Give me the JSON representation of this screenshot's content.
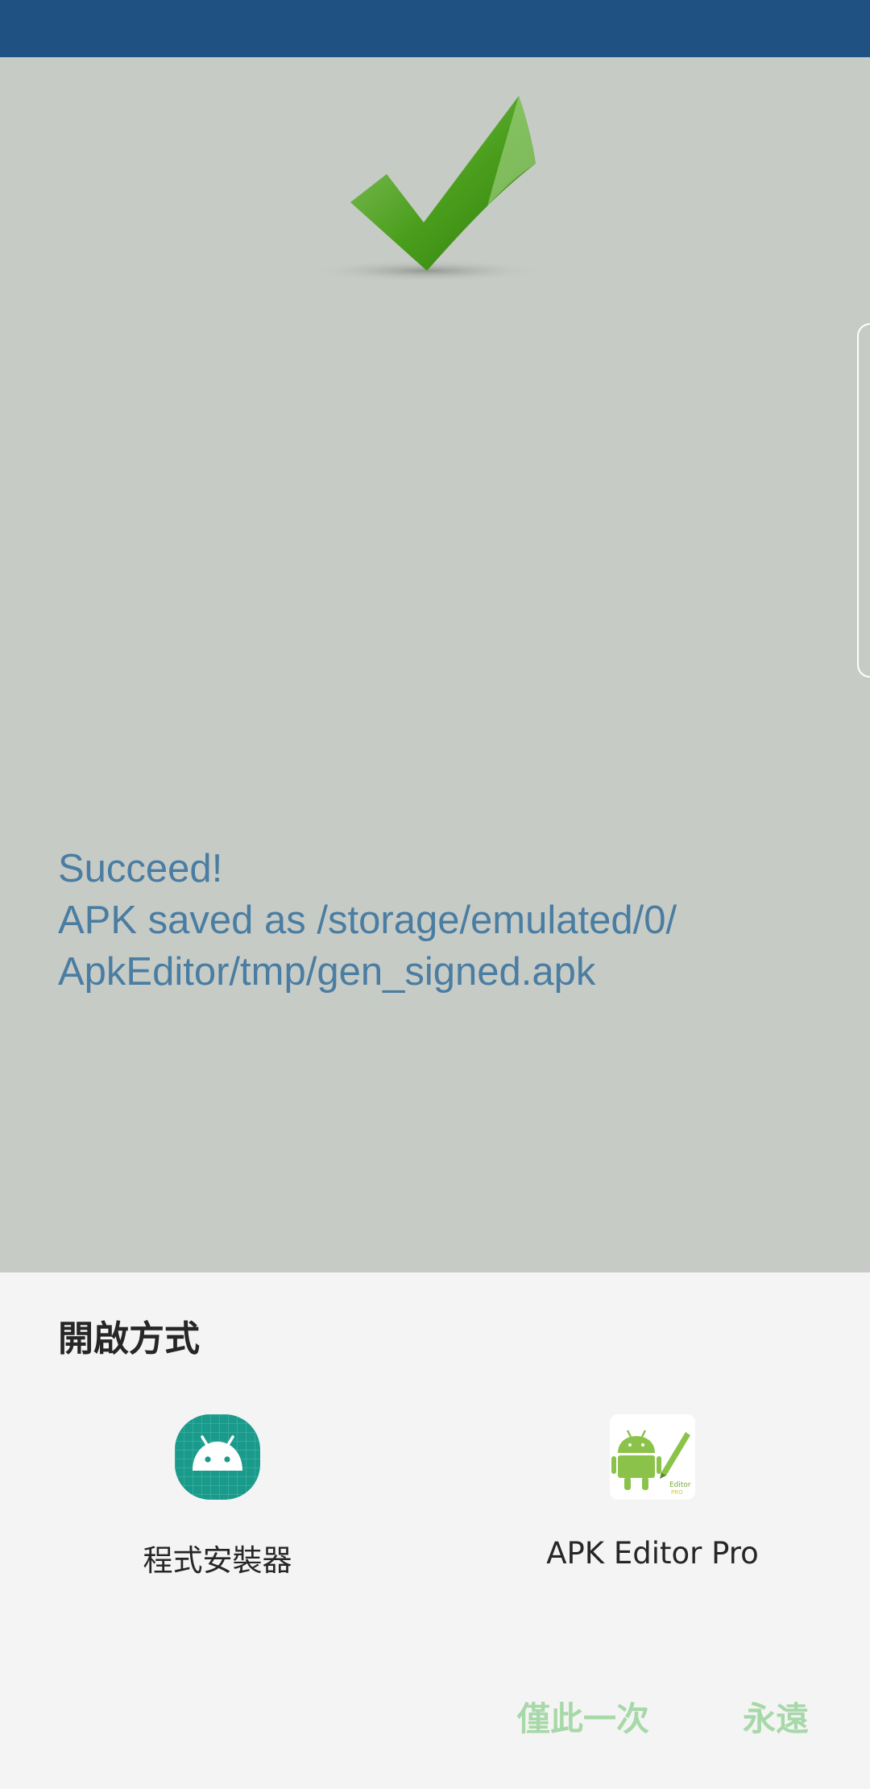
{
  "result": {
    "message": "Succeed!\nAPK saved as /storage/emulated/0/\nApkEditor/tmp/gen_signed.apk"
  },
  "chooser": {
    "title": "開啟方式",
    "apps": [
      {
        "label": "程式安裝器",
        "icon": "android-installer-icon"
      },
      {
        "label": "APK Editor Pro",
        "icon": "apk-editor-pro-icon"
      }
    ],
    "buttons": {
      "just_once": "僅此一次",
      "always": "永遠"
    }
  },
  "colors": {
    "status_bar": "#1f5282",
    "background": "#c7cbc6",
    "message_text": "#4a7da2",
    "sheet_background": "#f4f4f4",
    "button_text": "#a6d8a8",
    "installer_icon": "#1a9a8a",
    "android_green": "#8bc34a"
  }
}
